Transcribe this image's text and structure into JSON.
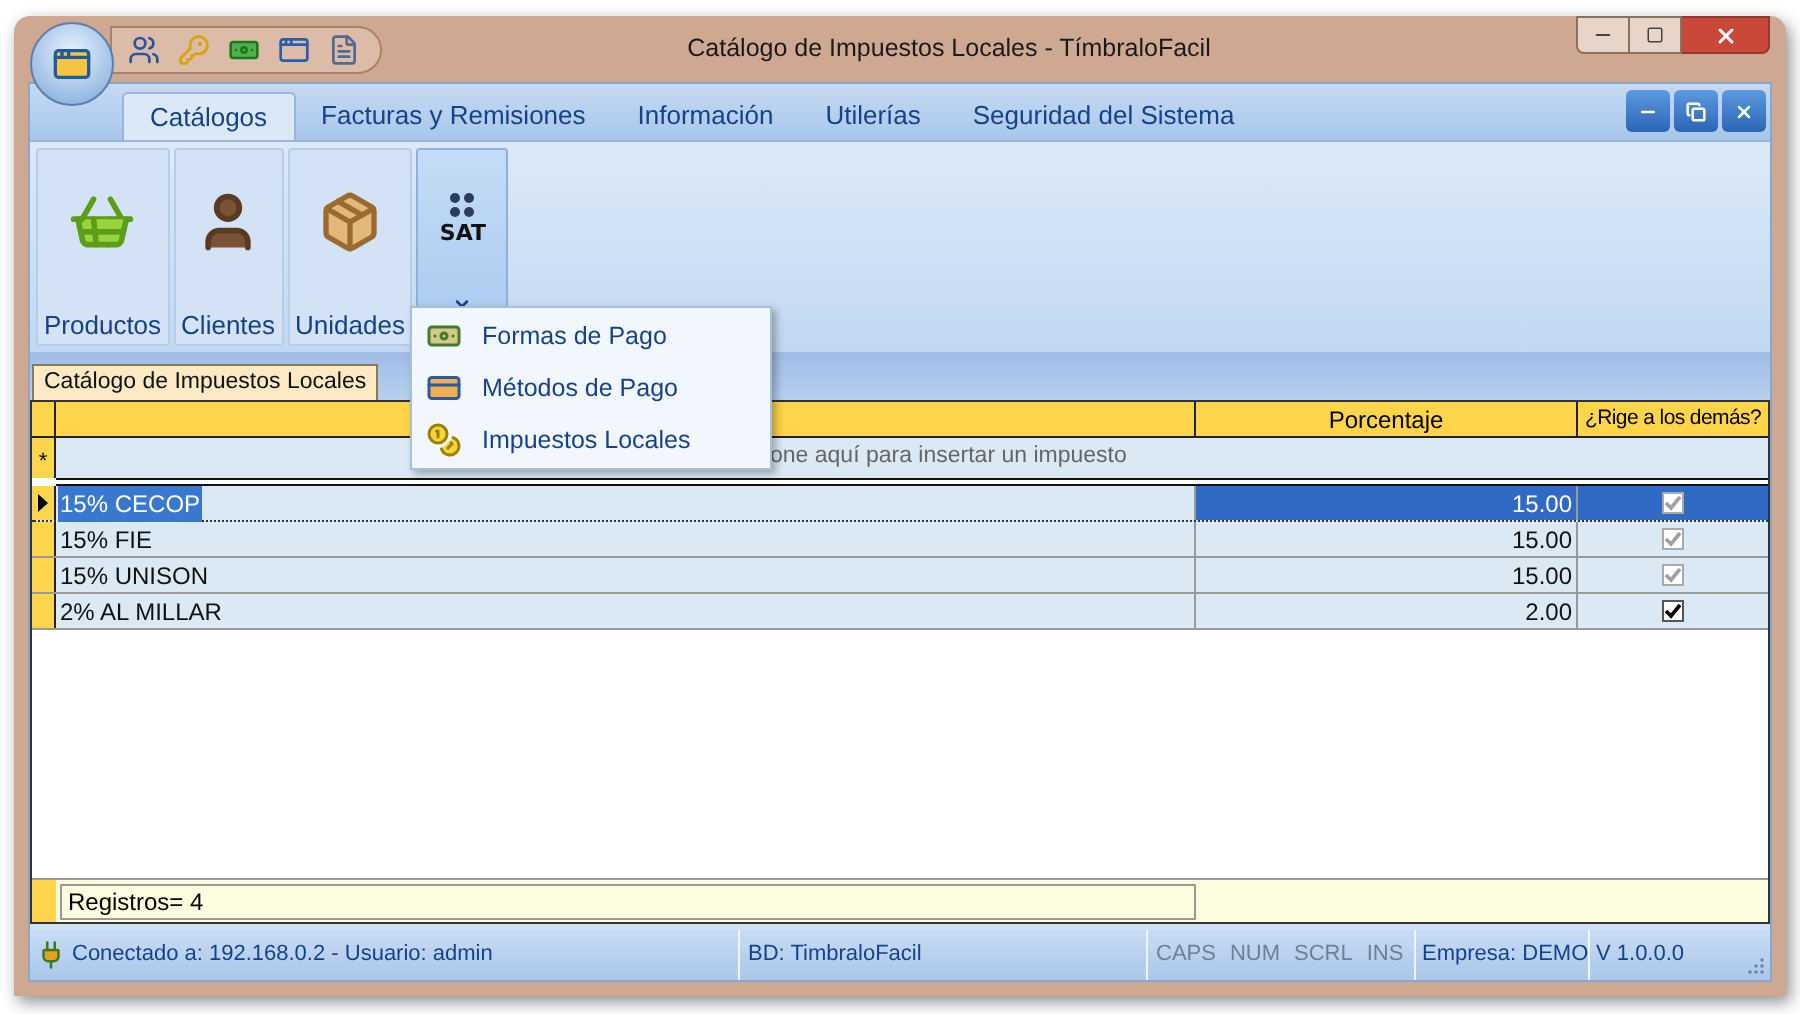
{
  "window": {
    "title": "Catálogo de Impuestos Locales - TímbraloFacil"
  },
  "ribbon": {
    "tabs": [
      {
        "label": "Catálogos",
        "selected": true
      },
      {
        "label": "Facturas y Remisiones",
        "selected": false
      },
      {
        "label": "Información",
        "selected": false
      },
      {
        "label": "Utilerías",
        "selected": false
      },
      {
        "label": "Seguridad del Sistema",
        "selected": false
      }
    ],
    "buttons": [
      {
        "kind": "basket",
        "label": "Productos",
        "open": false
      },
      {
        "kind": "person",
        "label": "Clientes",
        "open": false
      },
      {
        "kind": "box",
        "label": "Unidades",
        "open": false
      },
      {
        "kind": "sat",
        "logo": "SAT",
        "open": true
      }
    ]
  },
  "menu": {
    "items": [
      {
        "kind": "bills",
        "label": "Formas de Pago"
      },
      {
        "kind": "card",
        "label": "Métodos de Pago"
      },
      {
        "kind": "coins",
        "label": "Impuestos Locales"
      }
    ]
  },
  "document_tab": {
    "label": "Catálogo de Impuestos Locales"
  },
  "table": {
    "columns": [
      {
        "label": "Porcentaje"
      },
      {
        "label": "¿Rige a los demás?"
      }
    ],
    "new_row": {
      "marker": "*",
      "hint": "one aquí para insertar un impuesto"
    },
    "rows": [
      {
        "name": "15% CECOP",
        "percent": "15.00",
        "checked": true,
        "disabled": true,
        "selected": true
      },
      {
        "name": "15% FIE",
        "percent": "15.00",
        "checked": true,
        "disabled": true,
        "selected": false
      },
      {
        "name": "15% UNISON",
        "percent": "15.00",
        "checked": true,
        "disabled": true,
        "selected": false
      },
      {
        "name": "2% AL MILLAR",
        "percent": "2.00",
        "checked": true,
        "disabled": false,
        "selected": false
      }
    ],
    "footer": "Registros= 4"
  },
  "status_bar": {
    "connection": "Conectado a: 192.168.0.2 - Usuario: admin",
    "database": "BD: TimbraloFacil",
    "indicators": [
      {
        "label": "CAPS",
        "on": false
      },
      {
        "label": "NUM",
        "on": false
      },
      {
        "label": "SCRL",
        "on": false
      },
      {
        "label": "INS",
        "on": false
      }
    ],
    "company": "Empresa: DEMO",
    "version": "V 1.0.0.0"
  }
}
